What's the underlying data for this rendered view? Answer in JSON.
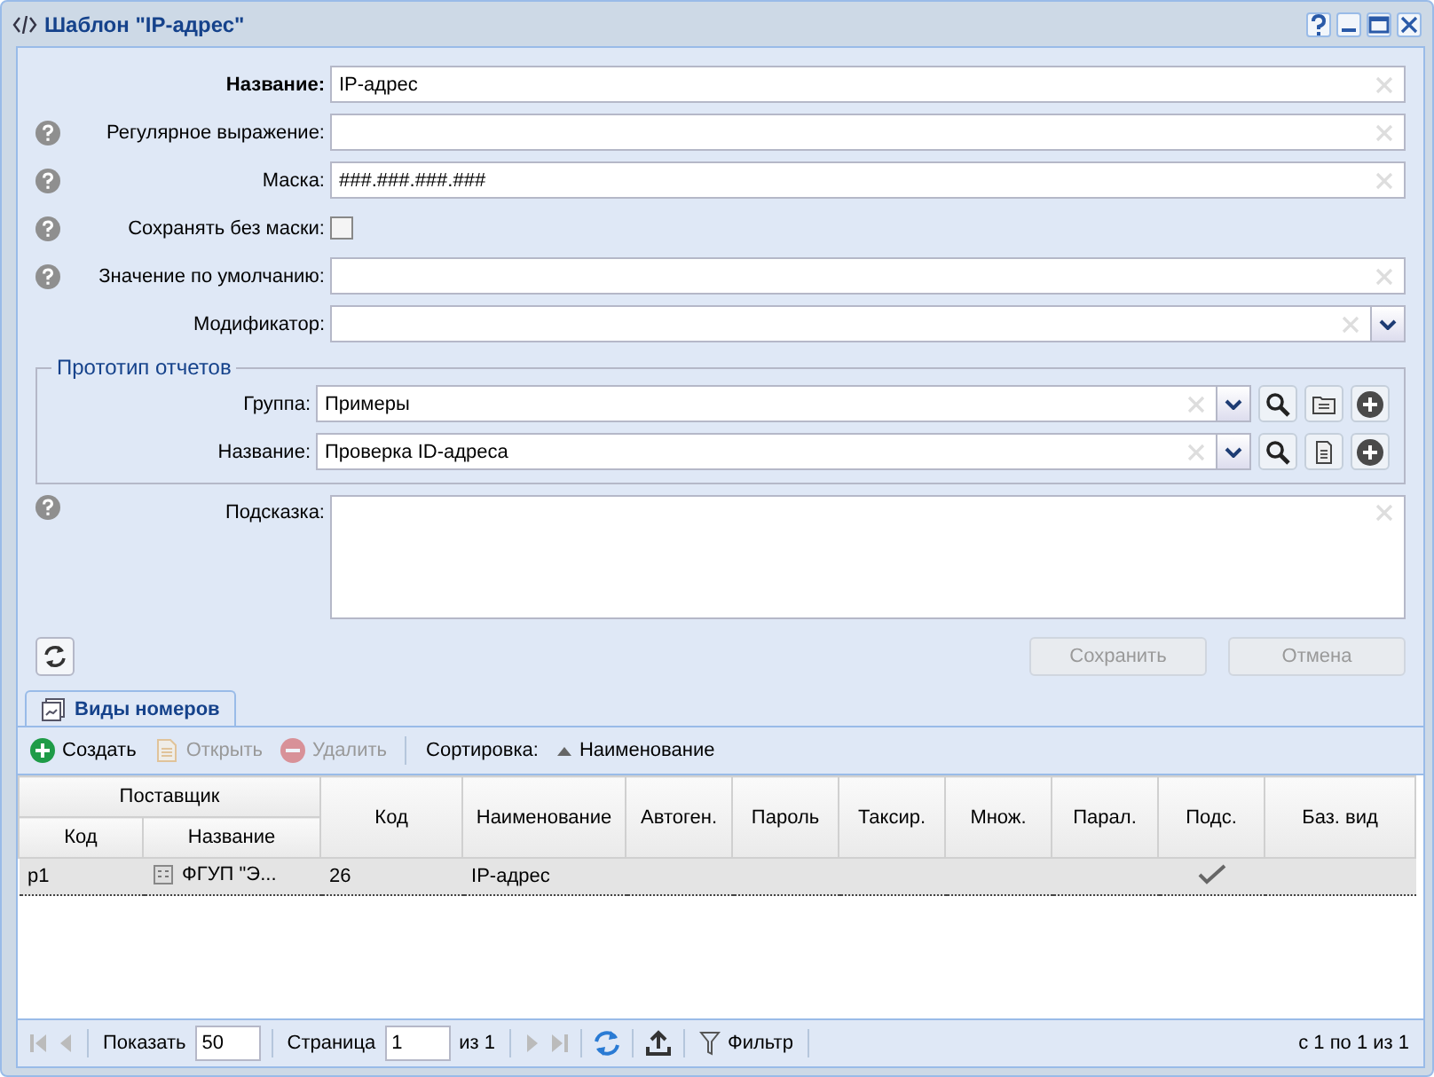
{
  "window": {
    "title": "Шаблон \"IP-адрес\""
  },
  "fields": [
    {
      "kind": "text",
      "label": "Название:",
      "value": "IP-адрес",
      "help": false,
      "required": true
    },
    {
      "kind": "text",
      "label": "Регулярное выражение:",
      "help": true,
      "required": false
    },
    {
      "kind": "text",
      "label": "Маска:",
      "value": "###.###.###.###",
      "help": true,
      "required": false
    },
    {
      "kind": "checkbox",
      "label": "Сохранять без маски:",
      "checked": false,
      "help": true,
      "required": false
    },
    {
      "kind": "text",
      "label": "Значение по умолчанию:",
      "help": true,
      "required": false
    },
    {
      "kind": "combo",
      "label": "Модификатор:",
      "help": false,
      "required": false
    }
  ],
  "report_prototype": {
    "legend": "Прототип отчетов",
    "rows": [
      {
        "label": "Группа:",
        "value": "Примеры"
      },
      {
        "label": "Название:",
        "value": "Проверка ID-адреса"
      }
    ]
  },
  "hint": {
    "label": "Подсказка:",
    "help": true
  },
  "actions": [
    {
      "label": "Сохранить",
      "disabled": true
    },
    {
      "label": "Отмена",
      "disabled": true
    }
  ],
  "tabs": [
    {
      "label": "Виды номеров",
      "selected": true
    }
  ],
  "toolbar": [
    {
      "kind": "button",
      "label": "Создать",
      "disabled": false
    },
    {
      "kind": "button",
      "label": "Открыть",
      "disabled": true
    },
    {
      "kind": "button",
      "label": "Удалить",
      "disabled": true
    },
    {
      "kind": "separator"
    },
    {
      "kind": "label",
      "label": "Сортировка:"
    },
    {
      "kind": "sort",
      "label": "Наименование"
    }
  ],
  "table": {
    "group_header": "Поставщик",
    "columns": [
      "Код",
      "Название",
      "Код",
      "Наименование",
      "Автоген.",
      "Пароль",
      "Таксир.",
      "Множ.",
      "Парал.",
      "Подс.",
      "Баз. вид"
    ],
    "rows": [
      {
        "selected": true,
        "cells": [
          "p1",
          "ФГУП \"Э...",
          "26",
          "IP-адрес",
          "",
          "",
          "",
          "",
          "",
          "",
          ""
        ],
        "checked": true
      }
    ]
  },
  "paging": {
    "show_label": "Показать",
    "page_size": "50",
    "page_label": "Страница",
    "page": "1",
    "of": "из 1",
    "filter": "Фильтр",
    "summary": "с 1 по 1 из 1"
  }
}
